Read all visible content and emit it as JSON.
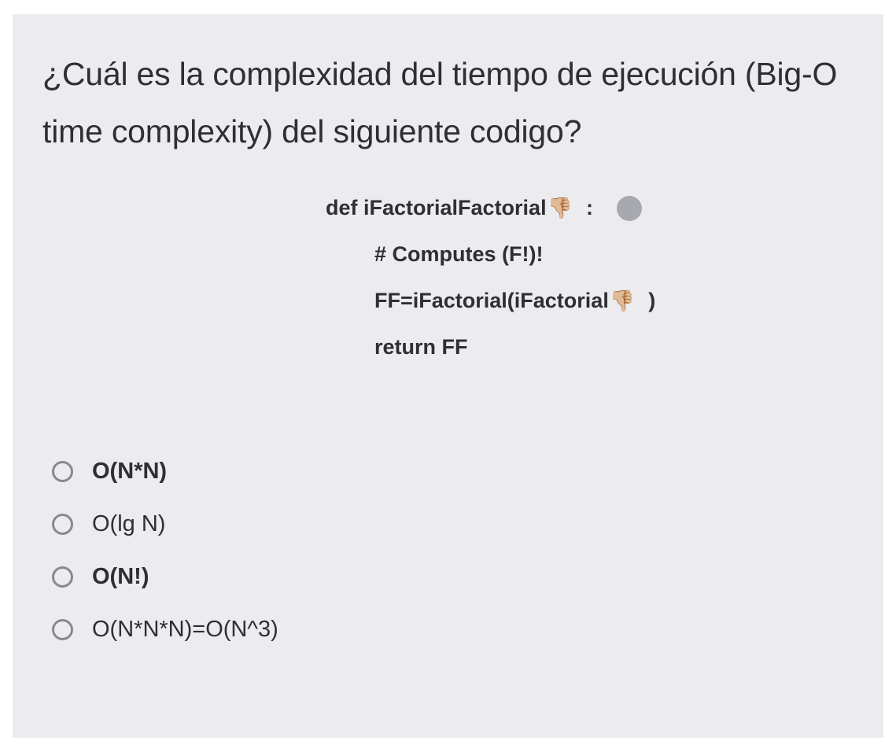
{
  "question": "¿Cuál es la complexidad del tiempo de ejecución (Big-O time complexity) del siguiente codigo?",
  "code": {
    "line1_a": "def iFactorialFactorial",
    "line1_b": "  :",
    "line2": "# Computes (F!)!",
    "line3_a": "FF=iFactorial(iFactorial",
    "line3_b": "  )",
    "line4": "return FF",
    "emoji": "👎🏼"
  },
  "options": [
    {
      "label": "O(N*N)",
      "bold": true
    },
    {
      "label": "O(lg N)",
      "bold": false
    },
    {
      "label": "O(N!)",
      "bold": true
    },
    {
      "label": "O(N*N*N)=O(N^3)",
      "bold": false
    }
  ]
}
